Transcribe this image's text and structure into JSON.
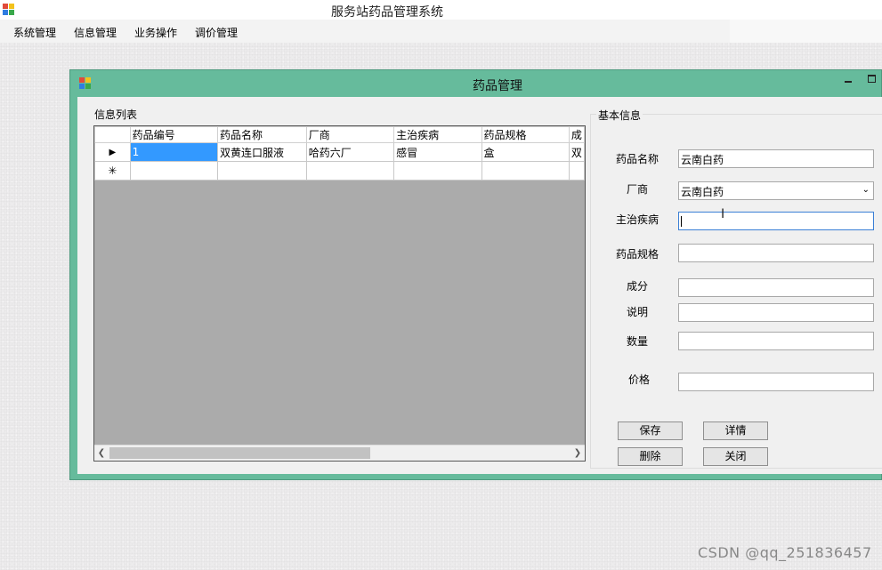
{
  "app": {
    "title": "服务站药品管理系统"
  },
  "menu": {
    "items": [
      "系统管理",
      "信息管理",
      "业务操作",
      "调价管理"
    ]
  },
  "child_window": {
    "title": "药品管理"
  },
  "list_group": {
    "label": "信息列表",
    "columns": [
      "药品编号",
      "药品名称",
      "厂商",
      "主治疾病",
      "药品规格",
      "成"
    ],
    "rows": [
      {
        "marker": "▶",
        "cells": [
          "1",
          "双黄连口服液",
          "哈药六厂",
          "感冒",
          "盒",
          "双"
        ]
      },
      {
        "marker": "✳",
        "cells": [
          "",
          "",
          "",
          "",
          "",
          ""
        ]
      }
    ]
  },
  "info_group": {
    "label": "基本信息",
    "fields": {
      "name_label": "药品名称",
      "name_value": "云南白药",
      "maker_label": "厂商",
      "maker_value": "云南白药",
      "disease_label": "主治疾病",
      "disease_value": "",
      "spec_label": "药品规格",
      "spec_value": "",
      "ingredients_label": "成分",
      "ingredients_value": "",
      "description_label": "说明",
      "description_value": "",
      "quantity_label": "数量",
      "quantity_value": "",
      "price_label": "价格",
      "price_value": ""
    },
    "buttons": {
      "save": "保存",
      "details": "详情",
      "delete": "删除",
      "close": "关闭"
    }
  },
  "watermark": "CSDN @qq_251836457"
}
